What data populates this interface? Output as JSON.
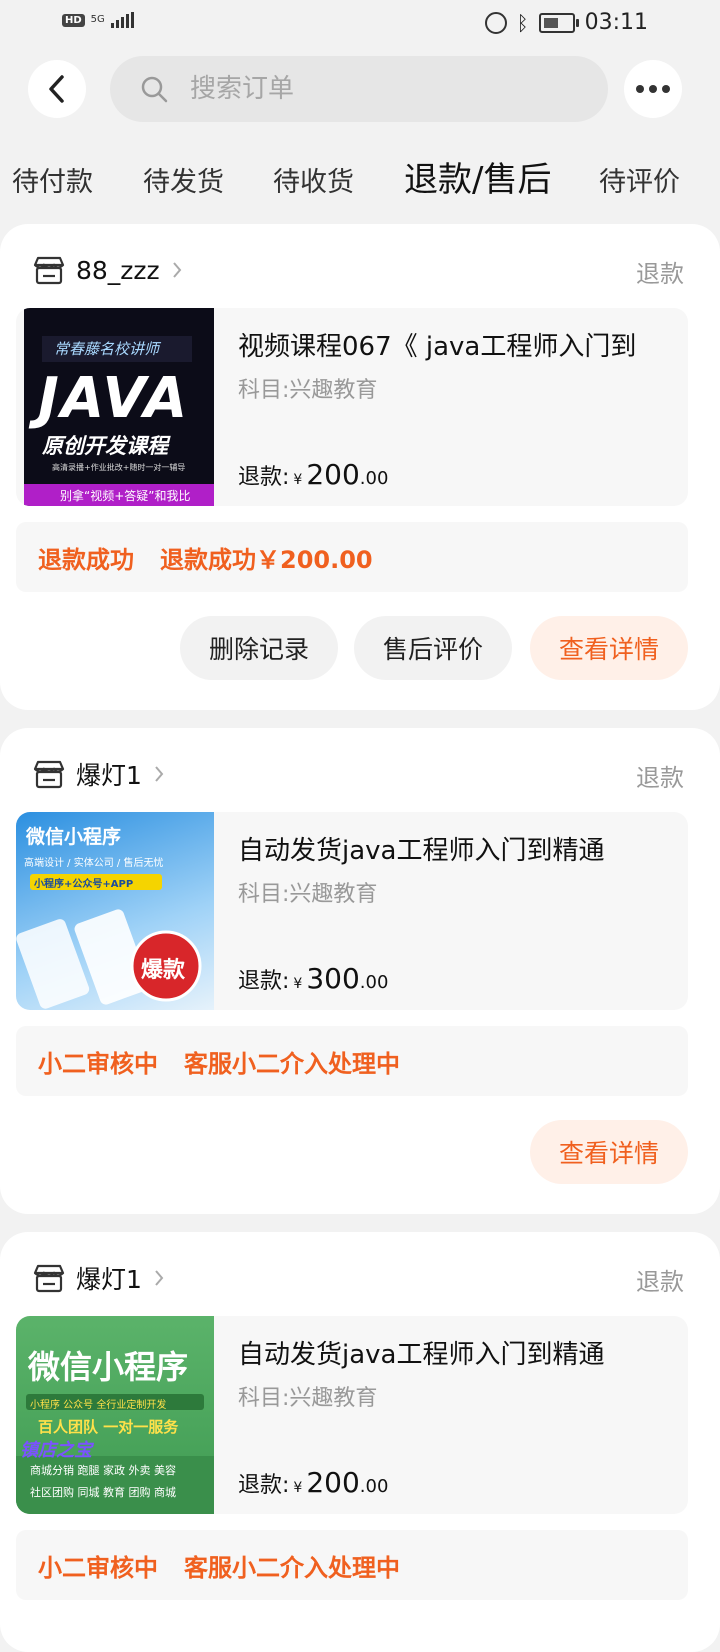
{
  "status_bar": {
    "hd": "HD",
    "network": "5G",
    "time": "03:11"
  },
  "search": {
    "placeholder": "搜索订单"
  },
  "tabs": [
    {
      "label": "待付款"
    },
    {
      "label": "待发货"
    },
    {
      "label": "待收货"
    },
    {
      "label": "退款/售后",
      "active": true
    },
    {
      "label": "待评价"
    }
  ],
  "orders": [
    {
      "shop": "88_zzz",
      "status": "退款",
      "title": "视频课程067《 java工程师入门到",
      "subject": "科目:兴趣教育",
      "refund_label": "退款:",
      "currency": "¥",
      "amount_int": "200",
      "amount_dec": ".00",
      "progress_state": "退款成功",
      "progress_detail": "退款成功￥200.00",
      "buttons": {
        "delete": "删除记录",
        "review": "售后评价",
        "details": "查看详情"
      },
      "thumb": {
        "tag": "常春藤名校讲师",
        "big": "JAVA",
        "sub": "原创开发课程",
        "line": "高清录播+作业批改+随时一对一辅导",
        "bottom": "别拿“视频+答疑”和我比"
      }
    },
    {
      "shop": "爆灯1",
      "status": "退款",
      "title": "自动发货java工程师入门到精通",
      "subject": "科目:兴趣教育",
      "refund_label": "退款:",
      "currency": "¥",
      "amount_int": "300",
      "amount_dec": ".00",
      "progress_state": "小二审核中",
      "progress_detail": "客服小二介入处理中",
      "buttons": {
        "details": "查看详情"
      },
      "thumb": {
        "title": "微信小程序",
        "line1": "高端设计 / 实体公司 / 售后无忧",
        "line2": "小程序+公众号+APP",
        "badge": "爆款"
      }
    },
    {
      "shop": "爆灯1",
      "status": "退款",
      "title": "自动发货java工程师入门到精通",
      "subject": "科目:兴趣教育",
      "refund_label": "退款:",
      "currency": "¥",
      "amount_int": "200",
      "amount_dec": ".00",
      "progress_state": "小二审核中",
      "progress_detail": "客服小二介入处理中",
      "thumb": {
        "title": "微信小程序",
        "tags": "小程序  公众号  全行业定制开发",
        "team": "百人团队 一对一服务",
        "brand": "镇店之宝",
        "row1": "商城分销 跑腿 家政 外卖 美容",
        "row2": "社区团购 同城 教育 团购 商城"
      }
    }
  ],
  "colors": {
    "accent": "#f0601f",
    "background": "#f2f2f2"
  }
}
